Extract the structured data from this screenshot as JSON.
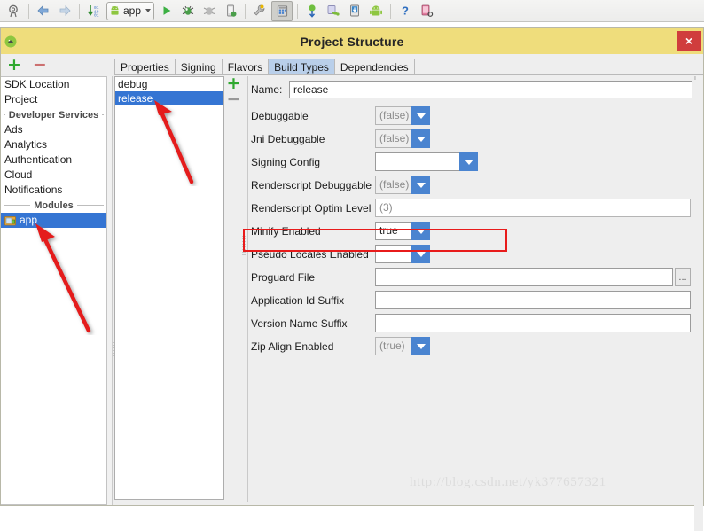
{
  "ide_toolbar": {
    "items": [
      {
        "name": "search-everywhere-icon",
        "glyph": "search"
      },
      {
        "name": "navigate-back-icon",
        "glyph": "arrow-left"
      },
      {
        "name": "navigate-forward-icon",
        "glyph": "arrow-right"
      },
      {
        "name": "sync-project-gradle-icon",
        "glyph": "sync-down"
      },
      {
        "name": "run-configuration-combo",
        "label": "app"
      },
      {
        "name": "run-icon",
        "glyph": "play"
      },
      {
        "name": "debug-icon",
        "glyph": "bug"
      },
      {
        "name": "coverage-icon",
        "glyph": "coverage"
      },
      {
        "name": "attach-debugger-icon",
        "glyph": "attach"
      },
      {
        "name": "sdk-manager-icon",
        "glyph": "wrench"
      },
      {
        "name": "project-structure-icon",
        "glyph": "structure"
      },
      {
        "name": "avd-manager-icon",
        "glyph": "avd"
      },
      {
        "name": "layout-inspector-icon",
        "glyph": "inspector"
      },
      {
        "name": "device-file-explorer-icon",
        "glyph": "device-files"
      },
      {
        "name": "android-icon",
        "glyph": "android"
      },
      {
        "name": "help-icon",
        "glyph": "question"
      },
      {
        "name": "device-monitor-icon",
        "glyph": "device-monitor"
      }
    ]
  },
  "dialog": {
    "title": "Project Structure",
    "close_label": "×",
    "title_bar_color": "#efdd7c",
    "close_button_color": "#d03d3d"
  },
  "sidebar": {
    "add_label": "+",
    "remove_label": "−",
    "items": [
      {
        "type": "item",
        "label": "SDK Location",
        "selected": false
      },
      {
        "type": "item",
        "label": "Project",
        "selected": false
      },
      {
        "type": "separator",
        "label": "Developer Services"
      },
      {
        "type": "item",
        "label": "Ads",
        "selected": false
      },
      {
        "type": "item",
        "label": "Analytics",
        "selected": false
      },
      {
        "type": "item",
        "label": "Authentication",
        "selected": false
      },
      {
        "type": "item",
        "label": "Cloud",
        "selected": false
      },
      {
        "type": "item",
        "label": "Notifications",
        "selected": false
      },
      {
        "type": "separator",
        "label": "Modules"
      },
      {
        "type": "module",
        "label": "app",
        "selected": true
      }
    ]
  },
  "tabs": [
    {
      "label": "Properties",
      "active": false
    },
    {
      "label": "Signing",
      "active": false
    },
    {
      "label": "Flavors",
      "active": false
    },
    {
      "label": "Build Types",
      "active": true
    },
    {
      "label": "Dependencies",
      "active": false
    }
  ],
  "build_types": {
    "add_label": "+",
    "remove_label": "−",
    "items": [
      {
        "label": "debug",
        "selected": false
      },
      {
        "label": "release",
        "selected": true
      }
    ]
  },
  "form": {
    "name_label": "Name:",
    "name_value": "release",
    "browse_label": "...",
    "rows": [
      {
        "label": "Debuggable",
        "kind": "combo",
        "value": "(false)",
        "disabled": true,
        "width": "small"
      },
      {
        "label": "Jni Debuggable",
        "kind": "combo",
        "value": "(false)",
        "disabled": true,
        "width": "small"
      },
      {
        "label": "Signing Config",
        "kind": "combo",
        "value": "",
        "disabled": false,
        "width": "wide"
      },
      {
        "label": "Renderscript Debuggable",
        "kind": "combo",
        "value": "(false)",
        "disabled": true,
        "width": "small"
      },
      {
        "label": "Renderscript Optim Level",
        "kind": "text",
        "value": "(3)",
        "disabled": true,
        "width": "full"
      },
      {
        "label": "Minify Enabled",
        "kind": "combo",
        "value": "true",
        "disabled": false,
        "width": "small",
        "highlighted": true
      },
      {
        "label": "Pseudo Locales Enabled",
        "kind": "combo",
        "value": "",
        "disabled": false,
        "width": "small"
      },
      {
        "label": "Proguard File",
        "kind": "browse",
        "value": "",
        "disabled": false,
        "width": "pg"
      },
      {
        "label": "Application Id Suffix",
        "kind": "text",
        "value": "",
        "disabled": false,
        "width": "full"
      },
      {
        "label": "Version Name Suffix",
        "kind": "text",
        "value": "",
        "disabled": false,
        "width": "full"
      },
      {
        "label": "Zip Align Enabled",
        "kind": "combo",
        "value": "(true)",
        "disabled": true,
        "width": "small"
      }
    ]
  },
  "annotations": {
    "highlight_color": "#e81b1b",
    "arrow_color": "#e41a1a",
    "arrows": [
      {
        "name": "arrow-to-release-item"
      },
      {
        "name": "arrow-to-app-module"
      }
    ]
  },
  "watermark": {
    "text": "http://blog.csdn.net/yk377657321"
  }
}
